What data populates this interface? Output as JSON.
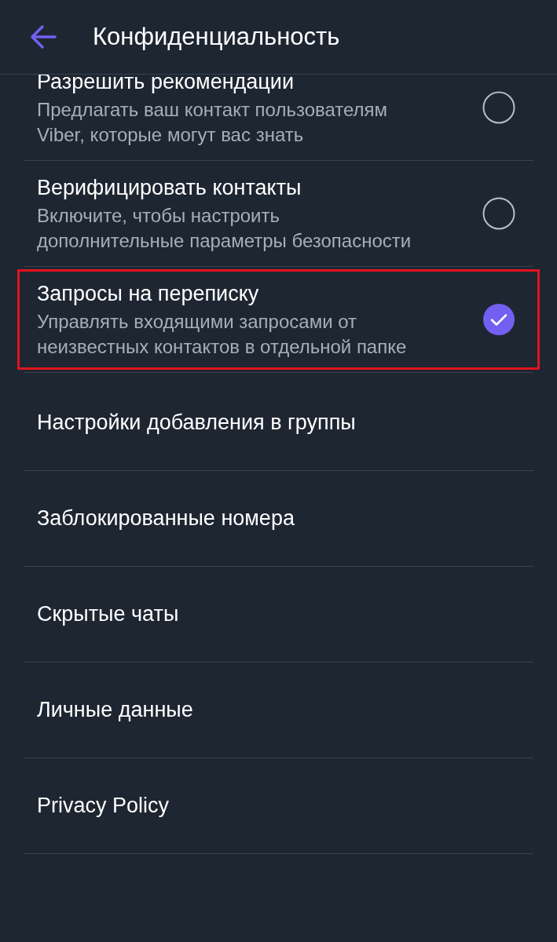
{
  "header": {
    "title": "Конфиденциальность"
  },
  "options": [
    {
      "kind": "toggle",
      "title": "Разрешить рекомендации",
      "description": "Предлагать ваш контакт пользователям Viber, которые могут вас знать",
      "checked": false,
      "highlighted": false
    },
    {
      "kind": "toggle",
      "title": "Верифицировать контакты",
      "description": "Включите, чтобы настроить дополнительные параметры безопасности",
      "checked": false,
      "highlighted": false
    },
    {
      "kind": "toggle",
      "title": "Запросы на переписку",
      "description": "Управлять входящими запросами от неизвестных контактов в отдельной папке",
      "checked": true,
      "highlighted": true
    },
    {
      "kind": "link",
      "title": "Настройки добавления в группы"
    },
    {
      "kind": "link",
      "title": "Заблокированные номера"
    },
    {
      "kind": "link",
      "title": "Скрытые чаты"
    },
    {
      "kind": "link",
      "title": "Личные данные"
    },
    {
      "kind": "link",
      "title": "Privacy Policy"
    }
  ]
}
